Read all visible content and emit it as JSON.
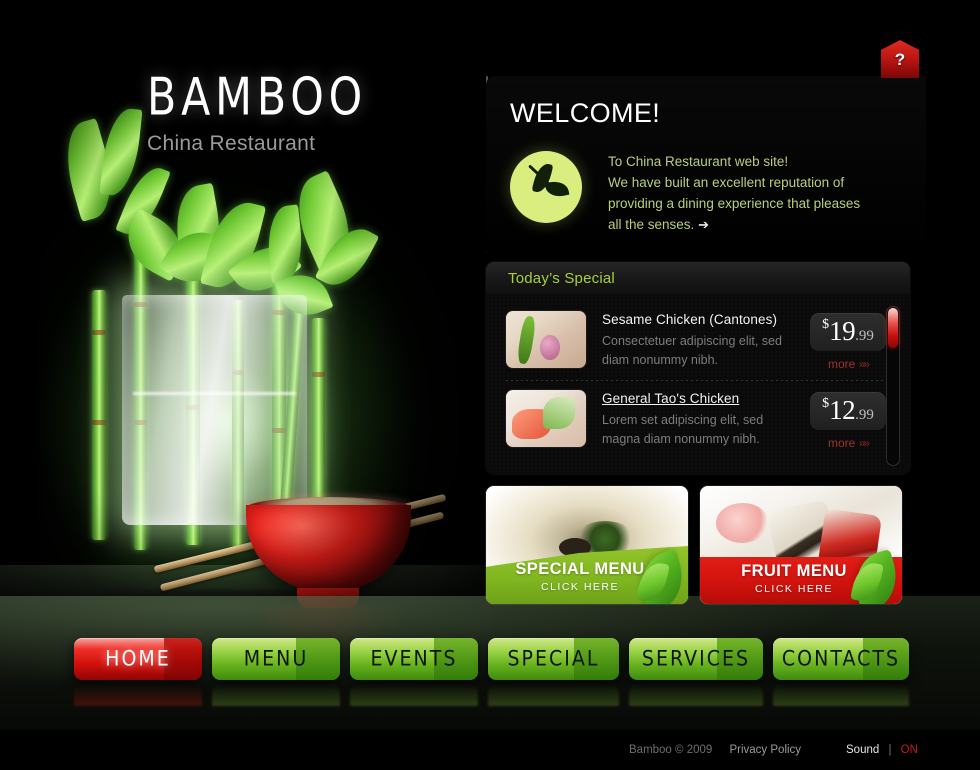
{
  "site": {
    "logo_mark": "BAMBOO",
    "logo_sub": "China Restaurant"
  },
  "help": {
    "label": "?",
    "icon": "question-mark-icon"
  },
  "welcome": {
    "title": "WELCOME!",
    "line1": "To China Restaurant web site!",
    "line2": "We have built an excellent reputation of",
    "line3": "providing a dining experience that pleases",
    "line4": "all the senses.",
    "arrow": "➔",
    "badge_icon": "bamboo-leaf-icon"
  },
  "special": {
    "header": "Today’s Special",
    "items": [
      {
        "title": "Sesame Chicken (Cantones)",
        "desc_line1": "Consectetuer adipiscing elit, sed",
        "desc_line2": "diam nonummy nibh.",
        "currency": "$",
        "price_int": "19",
        "price_dec": ".99",
        "more": "more",
        "more_chev": "»»"
      },
      {
        "title": "General Tao's Chicken",
        "desc_line1": "Lorem  set adipiscing elit, sed",
        "desc_line2": "magna diam nonummy nibh.",
        "currency": "$",
        "price_int": "12",
        "price_dec": ".99",
        "more": "more",
        "more_chev": "»»"
      }
    ]
  },
  "promos": [
    {
      "title": "SPECIAL MENU",
      "subtitle": "CLICK HERE",
      "accent": "#7fb520"
    },
    {
      "title": "FRUIT MENU",
      "subtitle": "CLICK HERE",
      "accent": "#cf120d"
    }
  ],
  "nav": [
    {
      "label": "HOME",
      "active": true
    },
    {
      "label": "MENU",
      "active": false
    },
    {
      "label": "EVENTS",
      "active": false
    },
    {
      "label": "SPECIAL",
      "active": false
    },
    {
      "label": "SERVICES",
      "active": false
    },
    {
      "label": "CONTACTS",
      "active": false
    }
  ],
  "footer": {
    "copyright": "Bamboo © 2009",
    "privacy": "Privacy Policy",
    "sound_label": "Sound",
    "sound_sep": "|",
    "sound_state": "ON"
  },
  "colors": {
    "accent_green": "#a7d13f",
    "accent_red": "#c01a13",
    "badge_green": "#d9ee7e",
    "text_body": "#b9cf7c"
  }
}
